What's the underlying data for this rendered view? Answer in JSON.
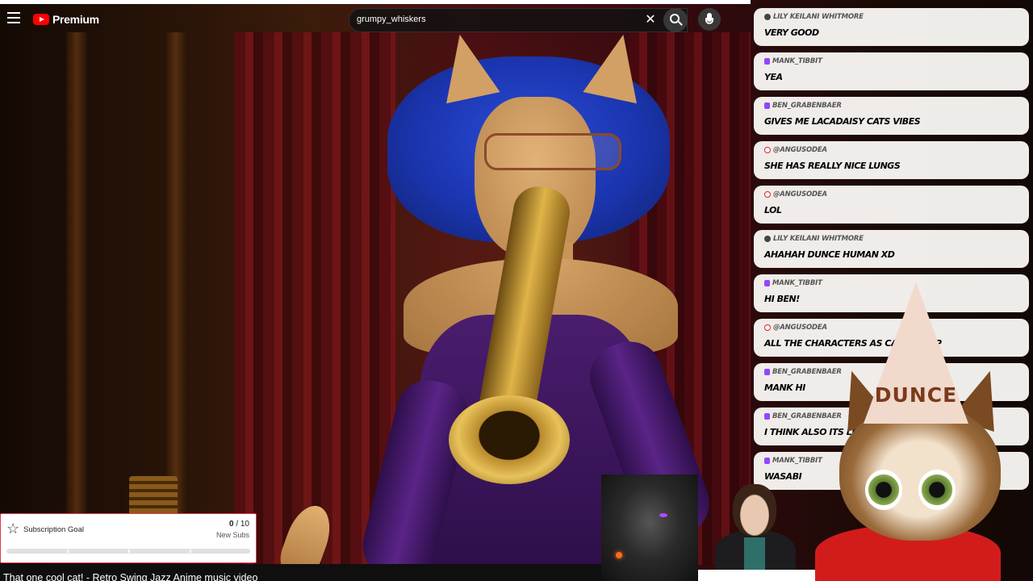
{
  "header": {
    "logo_text": "Premium",
    "search_value": "grumpy_whiskers",
    "clear_symbol": "✕",
    "icons": [
      "menu-icon",
      "youtube-logo-icon",
      "search-icon",
      "microphone-icon"
    ]
  },
  "chat": {
    "messages": [
      {
        "platform": "x",
        "user": "Lily Keilani Whitmore",
        "text": "very good"
      },
      {
        "platform": "twitch",
        "user": "Mank_Tibbit",
        "text": "yea"
      },
      {
        "platform": "twitch",
        "user": "Ben_Grabenbaer",
        "text": "gives me lacadaisy cats vibes"
      },
      {
        "platform": "youtube",
        "user": "@angusodea",
        "text": "she has really nice lungs"
      },
      {
        "platform": "youtube",
        "user": "@angusodea",
        "text": "lol"
      },
      {
        "platform": "x",
        "user": "Lily Keilani Whitmore",
        "text": "ahahah dunce human xd"
      },
      {
        "platform": "twitch",
        "user": "Mank_Tibbit",
        "text": "hi ben!"
      },
      {
        "platform": "youtube",
        "user": "@angusodea",
        "text": "all the characters as cats is sup"
      },
      {
        "platform": "twitch",
        "user": "Ben_Grabenbaer",
        "text": "mank hi"
      },
      {
        "platform": "twitch",
        "user": "Ben_Grabenbaer",
        "text": "I think also its le"
      },
      {
        "platform": "twitch",
        "user": "Mank_Tibbit",
        "text": "wasabi"
      }
    ],
    "platform_colors": {
      "twitch": "#9146ff",
      "youtube": "#e02020",
      "x": "#444444"
    }
  },
  "vtuber": {
    "hat_text": "DUNCE"
  },
  "goal": {
    "label": "Subscription Goal",
    "current": "0",
    "target": "/ 10",
    "unit": "New Subs",
    "progress_fraction": 0,
    "accent_color": "#e23a4c"
  },
  "video": {
    "title": "That one cool cat! - Retro Swing Jazz Anime music video"
  }
}
